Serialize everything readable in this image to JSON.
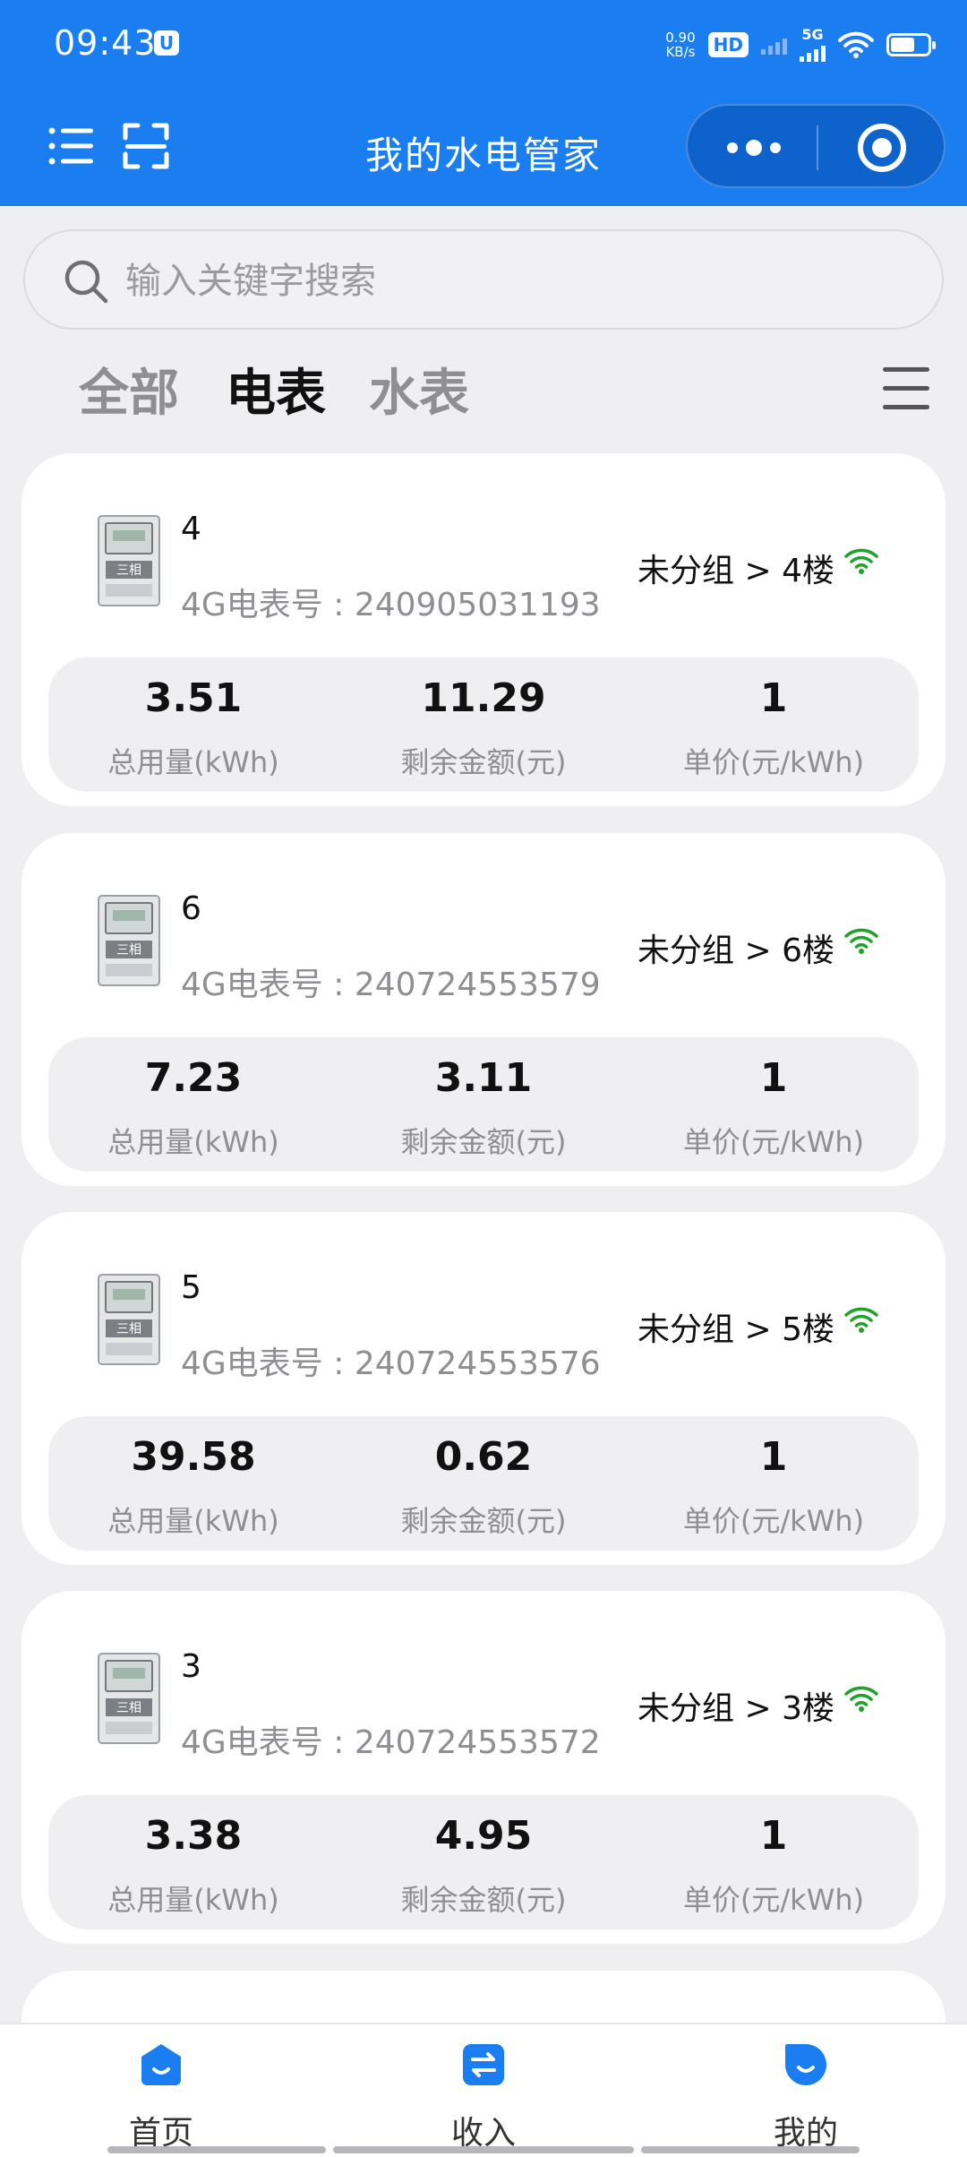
{
  "status_bar": {
    "time": "09:43",
    "net_speed_value": "0.90",
    "net_speed_unit": "KB/s",
    "hd_label": "HD",
    "network_type": "5G"
  },
  "header": {
    "title": "我的水电管家",
    "accent_color": "#1a7df0"
  },
  "search": {
    "placeholder": "输入关键字搜索",
    "value": ""
  },
  "tabs": [
    {
      "label": "全部",
      "active": false
    },
    {
      "label": "电表",
      "active": true
    },
    {
      "label": "水表",
      "active": false
    }
  ],
  "meters": [
    {
      "name": "4",
      "serial_label": "4G电表号 : 240905031193",
      "group": "未分组 > 4楼",
      "online": true,
      "total_usage": "3.51",
      "balance": "11.29",
      "unit_price": "1"
    },
    {
      "name": "6",
      "serial_label": "4G电表号 : 240724553579",
      "group": "未分组 > 6楼",
      "online": true,
      "total_usage": "7.23",
      "balance": "3.11",
      "unit_price": "1"
    },
    {
      "name": "5",
      "serial_label": "4G电表号 : 240724553576",
      "group": "未分组 > 5楼",
      "online": true,
      "total_usage": "39.58",
      "balance": "0.62",
      "unit_price": "1"
    },
    {
      "name": "3",
      "serial_label": "4G电表号 : 240724553572",
      "group": "未分组 > 3楼",
      "online": true,
      "total_usage": "3.38",
      "balance": "4.95",
      "unit_price": "1"
    }
  ],
  "stat_labels": {
    "total_usage": "总用量(kWh)",
    "balance": "剩余金额(元)",
    "unit_price": "单价(元/kWh)"
  },
  "meter_icon_text": "三相",
  "bottom_nav": [
    {
      "label": "首页",
      "icon": "home-icon"
    },
    {
      "label": "收入",
      "icon": "transfer-icon"
    },
    {
      "label": "我的",
      "icon": "profile-icon"
    }
  ]
}
